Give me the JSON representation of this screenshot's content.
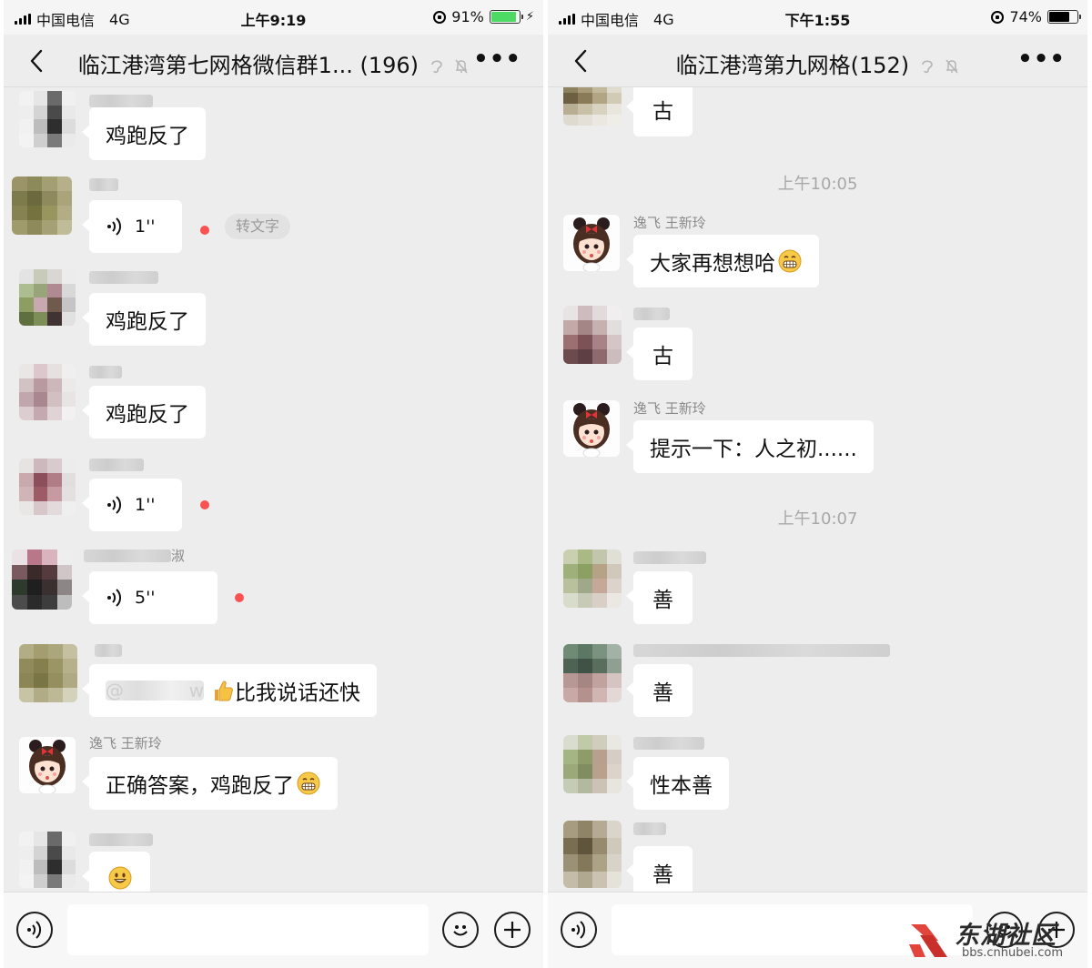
{
  "left": {
    "status": {
      "carrier": "中国电信",
      "network": "4G",
      "time": "上午9:19",
      "battery": "91%",
      "battery_level": 0.91,
      "battery_color": "#4cd964",
      "charging": true
    },
    "nav": {
      "title": "临江港湾第七网格微信群1... (196)"
    },
    "messages": [
      {
        "type": "text",
        "text": "鸡跑反了"
      },
      {
        "type": "voice",
        "duration": "1''",
        "unread": true,
        "to_text": "转文字"
      },
      {
        "type": "text",
        "text": "鸡跑反了"
      },
      {
        "type": "text",
        "text": "鸡跑反了"
      },
      {
        "type": "voice",
        "duration": "1''",
        "unread": true
      },
      {
        "type": "voice",
        "duration": "5''",
        "unread": true,
        "sender_suffix": "淑"
      },
      {
        "type": "text",
        "mention_visible": "@",
        "mention_tail": "w",
        "emoji": "thumbs-up",
        "text": "比我说话还快"
      },
      {
        "type": "text",
        "sender": "逸飞 王新玲",
        "text": "正确答案，鸡跑反了",
        "emoji": "grin"
      },
      {
        "type": "emoji",
        "emoji": "smile"
      }
    ]
  },
  "right": {
    "status": {
      "carrier": "中国电信",
      "network": "4G",
      "time": "下午1:55",
      "battery": "74%",
      "battery_level": 0.74,
      "battery_color": "#000000",
      "charging": false
    },
    "nav": {
      "title": "临江港湾第九网格(152)"
    },
    "messages": [
      {
        "type": "text",
        "text": "古"
      },
      {
        "type": "time",
        "text": "上午10:05"
      },
      {
        "type": "text",
        "sender": "逸飞 王新玲",
        "text": "大家再想想哈",
        "emoji": "grin"
      },
      {
        "type": "text",
        "text": "古"
      },
      {
        "type": "text",
        "sender": "逸飞 王新玲",
        "text": "提示一下：人之初......"
      },
      {
        "type": "time",
        "text": "上午10:07"
      },
      {
        "type": "text",
        "text": "善"
      },
      {
        "type": "text",
        "text": "善"
      },
      {
        "type": "text",
        "text": "性本善"
      },
      {
        "type": "text",
        "text": "善"
      }
    ]
  },
  "watermark": {
    "text": "东湖社区",
    "url": "bbs.cnhubei.com"
  },
  "icons": {
    "signal": "signal-bars-icon",
    "back": "chevron-left-icon",
    "ear": "earpiece-icon",
    "mute": "bell-slash-icon",
    "more": "more-dots-icon",
    "voice": "voice-icon",
    "emoji": "smiley-icon",
    "add": "plus-icon"
  }
}
